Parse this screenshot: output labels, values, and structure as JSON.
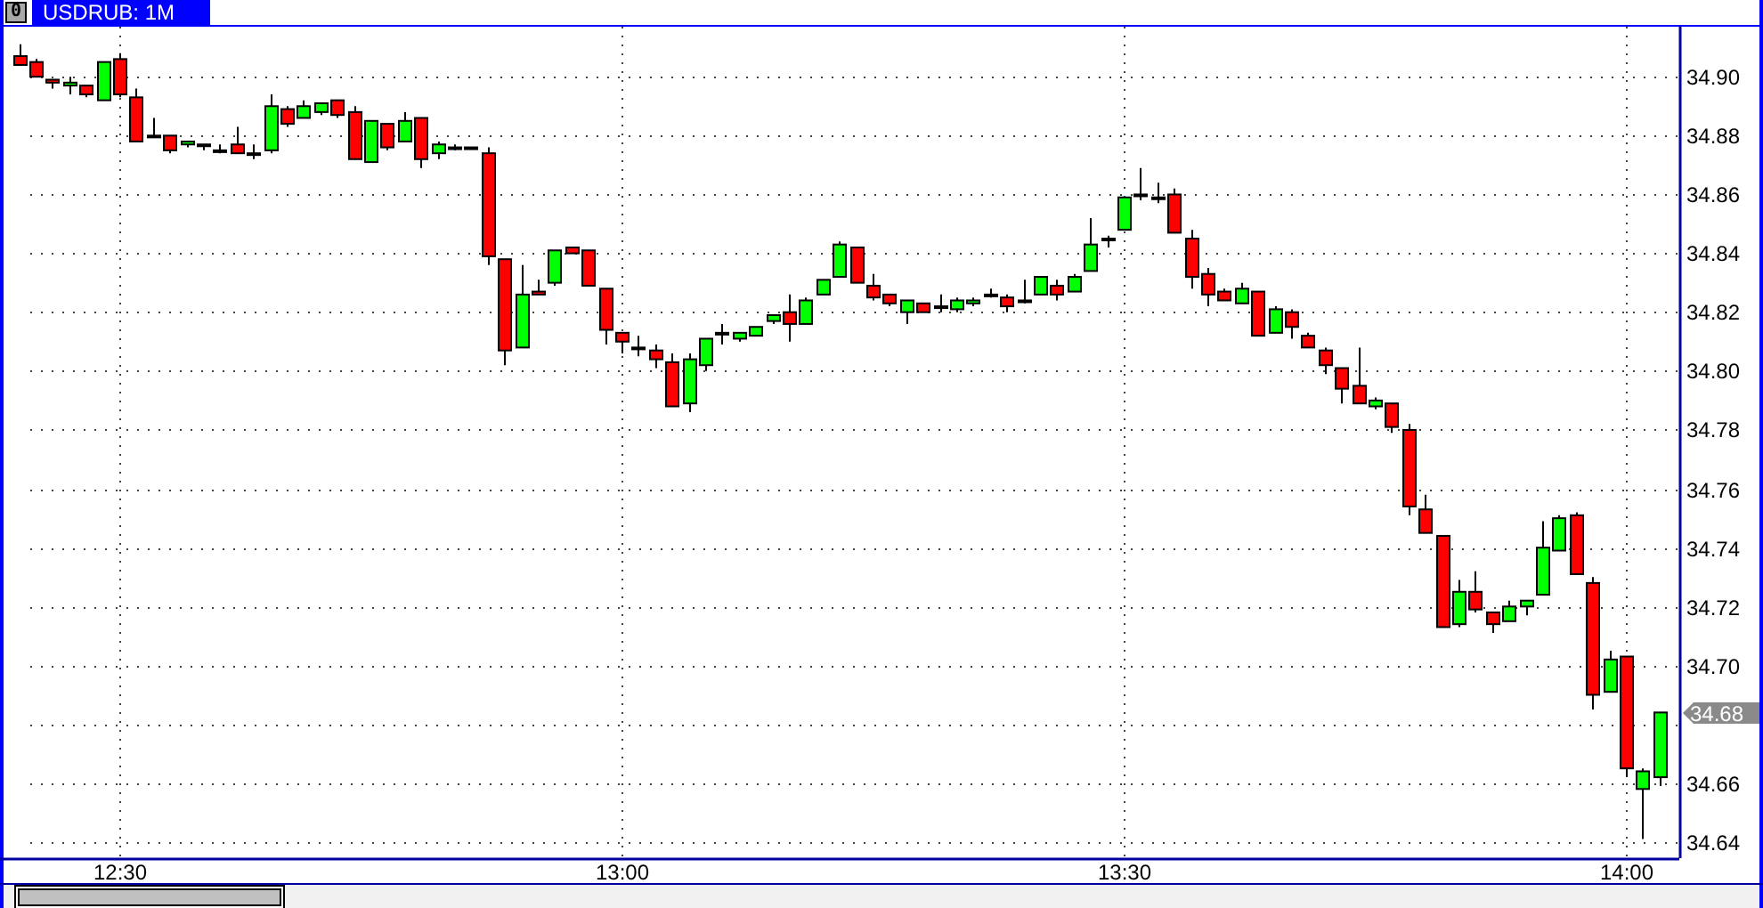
{
  "window": {
    "button": "0"
  },
  "chart": {
    "last_price": "34.68",
    "chart_data": {
      "type": "candlestick",
      "title": "USDRUB: 1M",
      "colors": [
        "#ff0000",
        "#ff0000",
        "#ff0000",
        "#00ff00",
        "#ff0000",
        "#00ff00",
        "#ff0000",
        "#ff0000",
        "#000000",
        "#ff0000",
        "#00ff00",
        "#000000",
        "#000000",
        "#ff0000",
        "#000000",
        "#00ff00",
        "#ff0000",
        "#00ff00",
        "#00ff00",
        "#ff0000",
        "#ff0000",
        "#00ff00",
        "#ff0000",
        "#00ff00",
        "#ff0000",
        "#00ff00",
        "#000000",
        "#000000",
        "#ff0000",
        "#ff0000",
        "#00ff00",
        "#ff0000",
        "#00ff00",
        "#ff0000",
        "#ff0000",
        "#ff0000",
        "#ff0000",
        "#000000",
        "#ff0000",
        "#ff0000",
        "#00ff00",
        "#00ff00",
        "#000000",
        "#00ff00",
        "#00ff00",
        "#00ff00",
        "#ff0000",
        "#00ff00",
        "#00ff00",
        "#00ff00",
        "#ff0000",
        "#ff0000",
        "#ff0000",
        "#00ff00",
        "#ff0000",
        "#000000",
        "#00ff00",
        "#00ff00",
        "#000000",
        "#ff0000",
        "#000000",
        "#00ff00",
        "#ff0000",
        "#00ff00",
        "#00ff00",
        "#000000",
        "#00ff00",
        "#000000",
        "#000000",
        "#ff0000",
        "#ff0000",
        "#ff0000",
        "#ff0000",
        "#00ff00",
        "#ff0000",
        "#00ff00",
        "#ff0000",
        "#ff0000",
        "#ff0000",
        "#ff0000",
        "#ff0000",
        "#00ff00",
        "#ff0000",
        "#ff0000",
        "#ff0000",
        "#ff0000",
        "#00ff00",
        "#ff0000",
        "#ff0000",
        "#00ff00",
        "#00ff00",
        "#00ff00",
        "#00ff00",
        "#ff0000",
        "#ff0000",
        "#00ff00",
        "#ff0000",
        "#00ff00",
        "#00ff00"
      ],
      "categories": [
        null,
        null,
        null,
        null,
        null,
        null,
        "12:30",
        null,
        null,
        null,
        null,
        null,
        null,
        null,
        null,
        null,
        null,
        null,
        null,
        null,
        null,
        null,
        null,
        null,
        null,
        null,
        null,
        null,
        null,
        null,
        null,
        null,
        null,
        null,
        null,
        null,
        "13:00",
        null,
        null,
        null,
        null,
        null,
        null,
        null,
        null,
        null,
        null,
        null,
        null,
        null,
        null,
        null,
        null,
        null,
        null,
        null,
        null,
        null,
        null,
        null,
        null,
        null,
        null,
        null,
        null,
        null,
        "13:30",
        null,
        null,
        null,
        null,
        null,
        null,
        null,
        null,
        null,
        null,
        null,
        null,
        null,
        null,
        null,
        null,
        null,
        null,
        null,
        null,
        null,
        null,
        null,
        null,
        null,
        null,
        null,
        null,
        null,
        "14:00",
        null,
        null
      ],
      "ohlc": [
        [
          34.907,
          34.911,
          34.904,
          34.904
        ],
        [
          34.905,
          34.906,
          34.9,
          34.9
        ],
        [
          34.899,
          34.899,
          34.896,
          34.898
        ],
        [
          34.897,
          34.9,
          34.894,
          34.898
        ],
        [
          34.897,
          34.897,
          34.893,
          34.894
        ],
        [
          34.892,
          34.905,
          34.892,
          34.905
        ],
        [
          34.906,
          34.908,
          34.893,
          34.894
        ],
        [
          34.893,
          34.896,
          34.878,
          34.878
        ],
        [
          34.88,
          34.886,
          34.88,
          34.88
        ],
        [
          34.88,
          34.88,
          34.874,
          34.875
        ],
        [
          34.877,
          34.878,
          34.876,
          34.878
        ],
        [
          34.877,
          34.877,
          34.875,
          34.877
        ],
        [
          34.875,
          34.877,
          34.874,
          34.875
        ],
        [
          34.877,
          34.883,
          34.874,
          34.874
        ],
        [
          34.874,
          34.877,
          34.872,
          34.874
        ],
        [
          34.875,
          34.894,
          34.874,
          34.89
        ],
        [
          34.889,
          34.89,
          34.883,
          34.884
        ],
        [
          34.886,
          34.892,
          34.886,
          34.89
        ],
        [
          34.888,
          34.891,
          34.887,
          34.891
        ],
        [
          34.892,
          34.892,
          34.886,
          34.887
        ],
        [
          34.888,
          34.89,
          34.872,
          34.872
        ],
        [
          34.871,
          34.885,
          34.871,
          34.885
        ],
        [
          34.884,
          34.884,
          34.875,
          34.876
        ],
        [
          34.878,
          34.888,
          34.878,
          34.885
        ],
        [
          34.886,
          34.886,
          34.869,
          34.872
        ],
        [
          34.874,
          34.878,
          34.872,
          34.877
        ],
        [
          34.876,
          34.877,
          34.875,
          34.876
        ],
        [
          34.876,
          34.876,
          34.876,
          34.876
        ],
        [
          34.874,
          34.876,
          34.836,
          34.839
        ],
        [
          34.838,
          34.838,
          34.802,
          34.807
        ],
        [
          34.808,
          34.836,
          34.808,
          34.826
        ],
        [
          34.827,
          34.831,
          34.826,
          34.826
        ],
        [
          34.83,
          34.841,
          34.829,
          34.841
        ],
        [
          34.842,
          34.842,
          34.84,
          34.84
        ],
        [
          34.841,
          34.841,
          34.829,
          34.829
        ],
        [
          34.828,
          34.828,
          34.809,
          34.814
        ],
        [
          34.813,
          34.813,
          34.806,
          34.81
        ],
        [
          34.808,
          34.812,
          34.805,
          34.808
        ],
        [
          34.807,
          34.809,
          34.801,
          34.804
        ],
        [
          34.803,
          34.806,
          34.788,
          34.788
        ],
        [
          34.789,
          34.806,
          34.786,
          34.804
        ],
        [
          34.802,
          34.811,
          34.8,
          34.811
        ],
        [
          34.813,
          34.816,
          34.809,
          34.813
        ],
        [
          34.811,
          34.813,
          34.81,
          34.813
        ],
        [
          34.812,
          34.815,
          34.812,
          34.815
        ],
        [
          34.817,
          34.819,
          34.816,
          34.819
        ],
        [
          34.82,
          34.826,
          34.81,
          34.816
        ],
        [
          34.816,
          34.825,
          34.816,
          34.824
        ],
        [
          34.826,
          34.831,
          34.826,
          34.831
        ],
        [
          34.832,
          34.844,
          34.832,
          34.843
        ],
        [
          34.842,
          34.842,
          34.83,
          34.83
        ],
        [
          34.829,
          34.833,
          34.824,
          34.825
        ],
        [
          34.826,
          34.826,
          34.822,
          34.823
        ],
        [
          34.82,
          34.824,
          34.816,
          34.824
        ],
        [
          34.823,
          34.823,
          34.82,
          34.82
        ],
        [
          34.822,
          34.826,
          34.82,
          34.822
        ],
        [
          34.821,
          34.825,
          34.82,
          34.824
        ],
        [
          34.823,
          34.825,
          34.822,
          34.824
        ],
        [
          34.826,
          34.828,
          34.825,
          34.826
        ],
        [
          34.825,
          34.826,
          34.82,
          34.822
        ],
        [
          34.824,
          34.831,
          34.823,
          34.824
        ],
        [
          34.826,
          34.832,
          34.826,
          34.832
        ],
        [
          34.829,
          34.831,
          34.824,
          34.826
        ],
        [
          34.827,
          34.833,
          34.827,
          34.832
        ],
        [
          34.834,
          34.852,
          34.834,
          34.843
        ],
        [
          34.845,
          34.846,
          34.842,
          34.845
        ],
        [
          34.848,
          34.859,
          34.848,
          34.859
        ],
        [
          34.86,
          34.869,
          34.858,
          34.86
        ],
        [
          34.859,
          34.864,
          34.857,
          34.859
        ],
        [
          34.86,
          34.862,
          34.847,
          34.847
        ],
        [
          34.845,
          34.848,
          34.828,
          34.832
        ],
        [
          34.833,
          34.835,
          34.822,
          34.826
        ],
        [
          34.827,
          34.828,
          34.824,
          34.824
        ],
        [
          34.823,
          34.83,
          34.823,
          34.828
        ],
        [
          34.827,
          34.827,
          34.812,
          34.812
        ],
        [
          34.813,
          34.822,
          34.813,
          34.821
        ],
        [
          34.82,
          34.821,
          34.811,
          34.815
        ],
        [
          34.812,
          34.813,
          34.808,
          34.808
        ],
        [
          34.807,
          34.808,
          34.799,
          34.802
        ],
        [
          34.801,
          34.801,
          34.789,
          34.794
        ],
        [
          34.795,
          34.808,
          34.789,
          34.789
        ],
        [
          34.788,
          34.791,
          34.787,
          34.79
        ],
        [
          34.789,
          34.789,
          34.779,
          34.781
        ],
        [
          34.78,
          34.782,
          34.751,
          34.754
        ],
        [
          34.753,
          34.758,
          34.745,
          34.745
        ],
        [
          34.744,
          34.744,
          34.713,
          34.713
        ],
        [
          34.714,
          34.729,
          34.713,
          34.725
        ],
        [
          34.725,
          34.732,
          34.718,
          34.719
        ],
        [
          34.718,
          34.718,
          34.711,
          34.714
        ],
        [
          34.715,
          34.722,
          34.715,
          34.72
        ],
        [
          34.72,
          34.722,
          34.717,
          34.722
        ],
        [
          34.724,
          34.749,
          34.724,
          34.74
        ],
        [
          34.739,
          34.751,
          34.739,
          34.75
        ],
        [
          34.751,
          34.752,
          34.731,
          34.731
        ],
        [
          34.728,
          34.73,
          34.685,
          34.69
        ],
        [
          34.691,
          34.705,
          34.691,
          34.702
        ],
        [
          34.703,
          34.703,
          34.662,
          34.665
        ],
        [
          34.658,
          34.665,
          34.641,
          34.664
        ],
        [
          34.662,
          34.684,
          34.659,
          34.684
        ]
      ],
      "ylim": [
        34.6345,
        34.917
      ],
      "grid": true,
      "yticks": [
        {
          "value": 34.64,
          "label": "34.64"
        },
        {
          "value": 34.66,
          "label": "34.66"
        },
        34.68,
        {
          "value": 34.7,
          "label": "34.70"
        },
        {
          "value": 34.72,
          "label": "34.72"
        },
        {
          "value": 34.74,
          "label": "34.74"
        },
        {
          "value": 34.76,
          "label": "34.76"
        },
        {
          "value": 34.78,
          "label": "34.78"
        },
        {
          "value": 34.8,
          "label": "34.80"
        },
        {
          "value": 34.82,
          "label": "34.82"
        },
        {
          "value": 34.84,
          "label": "34.84"
        },
        {
          "value": 34.86,
          "label": "34.86"
        },
        {
          "value": 34.88,
          "label": "34.88"
        },
        {
          "value": 34.9,
          "label": "34.90"
        }
      ]
    }
  }
}
